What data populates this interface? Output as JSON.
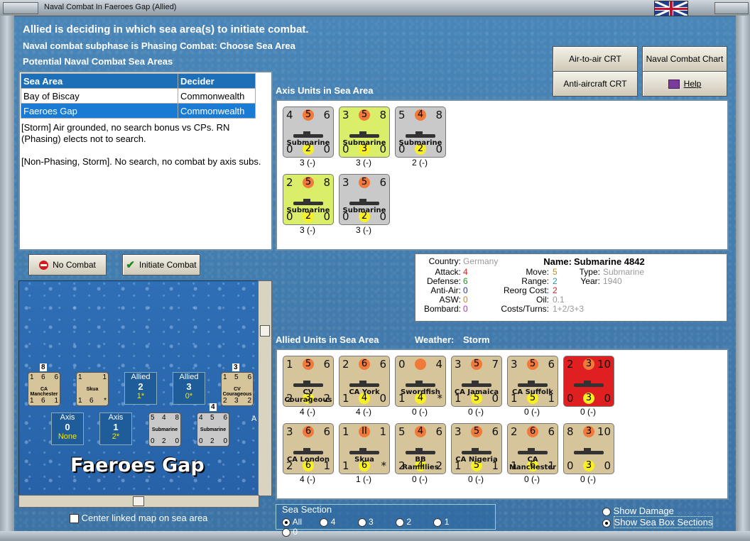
{
  "window": {
    "title": "Naval Combat In Faeroes Gap (Allied)"
  },
  "header": {
    "line1": "Allied is deciding in which sea area(s) to initiate combat.",
    "line2": "Naval combat subphase is Phasing Combat: Choose Sea Area",
    "line3": "Potential Naval Combat Sea Areas"
  },
  "buttons": {
    "air_to_air": "Air-to-air CRT",
    "naval_chart": "Naval Combat Chart",
    "anti_aircraft": "Anti-aircraft CRT",
    "help": "Help",
    "no_combat": "No Combat",
    "initiate_combat": "Initiate Combat"
  },
  "sea_table": {
    "headers": [
      "Sea Area",
      "Decider"
    ],
    "rows": [
      {
        "area": "Bay of Biscay",
        "decider": "Commonwealth"
      },
      {
        "area": "Faeroes Gap",
        "decider": "Commonwealth"
      }
    ]
  },
  "notes": [
    "[Storm] Air grounded, no search bonus vs CPs.  RN (Phasing) elects not to search.",
    "[Non-Phasing, Storm].  No search, no combat by axis subs."
  ],
  "axis_section": {
    "title": "Axis Units in Sea Area"
  },
  "axis_units": [
    {
      "tl": "4",
      "tc": "5",
      "tr": "6",
      "name": "Submarine",
      "bl": "0",
      "bc": "2",
      "br": "0",
      "label": "3 (-)",
      "color": "#c9c9c9"
    },
    {
      "tl": "3",
      "tc": "5",
      "tr": "8",
      "name": "Submarine",
      "bl": "0",
      "bc": "3",
      "br": "0",
      "label": "3 (-)",
      "color": "#dbee6a"
    },
    {
      "tl": "5",
      "tc": "4",
      "tr": "8",
      "name": "Submarine",
      "bl": "0",
      "bc": "2",
      "br": "0",
      "label": "2 (-)",
      "color": "#c9c9c9"
    },
    {
      "tl": "2",
      "tc": "5",
      "tr": "8",
      "name": "Submarine",
      "bl": "0",
      "bc": "2",
      "br": "0",
      "label": "3 (-)",
      "color": "#dbee6a"
    },
    {
      "tl": "3",
      "tc": "5",
      "tr": "6",
      "name": "Submarine",
      "bl": "0",
      "bc": "2",
      "br": "0",
      "label": "3 (-)",
      "color": "#c9c9c9"
    }
  ],
  "info": {
    "country_k": "Country:",
    "country_v": "Germany",
    "attack_k": "Attack:",
    "attack_v": "4",
    "defense_k": "Defense:",
    "defense_v": "6",
    "antiair_k": "Anti-Air:",
    "antiair_v": "0",
    "asw_k": "ASW:",
    "asw_v": "0",
    "bombard_k": "Bombard:",
    "bombard_v": "0",
    "move_k": "Move:",
    "move_v": "5",
    "range_k": "Range:",
    "range_v": "2",
    "reorg_k": "Reorg Cost:",
    "reorg_v": "2",
    "oil_k": "Oil:",
    "oil_v": "0.1",
    "costs_k": "Costs/Turns:",
    "costs_v": "1+2/3+3",
    "name_k": "Name:",
    "name_v": "Submarine 4842",
    "type_k": "Type:",
    "type_v": "Submarine",
    "year_k": "Year:",
    "year_v": "1940"
  },
  "allied_section": {
    "title": "Allied Units in Sea Area",
    "weather_label": "Weather:",
    "weather_value": "Storm"
  },
  "allied_units": [
    {
      "tl": "1",
      "tc": "5",
      "tr": "6",
      "name": "CV Courageous",
      "bl": "2",
      "bc": "3",
      "br": "2",
      "label": "4 (-)",
      "color": "#d6c49a"
    },
    {
      "tl": "2",
      "tc": "6",
      "tr": "6",
      "name": "CA York",
      "bl": "1",
      "bc": "4",
      "br": "0",
      "label": "4 (-)",
      "color": "#d6c49a"
    },
    {
      "tl": "0",
      "tc": "",
      "tr": "4",
      "name": "Swordfish",
      "bl": "1",
      "bc": "4",
      "br": "*",
      "label": "0 (-)",
      "color": "#d6c49a"
    },
    {
      "tl": "3",
      "tc": "5",
      "tr": "7",
      "name": "CA Jamaica",
      "bl": "1",
      "bc": "5",
      "br": "0",
      "label": "0 (-)",
      "color": "#d6c49a"
    },
    {
      "tl": "3",
      "tc": "5",
      "tr": "6",
      "name": "CA Suffolk",
      "bl": "1",
      "bc": "5",
      "br": "1",
      "label": "0 (-)",
      "color": "#d6c49a"
    },
    {
      "tl": "2",
      "tc": "3",
      "tr": "10",
      "name": "",
      "bl": "0",
      "bc": "3",
      "br": "0",
      "label": "0 (-)",
      "color": "#e02020"
    },
    {
      "tl": "3",
      "tc": "6",
      "tr": "6",
      "name": "CA London",
      "bl": "2",
      "bc": "6",
      "br": "1",
      "label": "4 (-)",
      "color": "#d6c49a"
    },
    {
      "tl": "1",
      "tc": "II",
      "tr": "1",
      "name": "Skua",
      "bl": "1",
      "bc": "6",
      "br": "*",
      "label": "1 (-)",
      "color": "#d6c49a"
    },
    {
      "tl": "5",
      "tc": "4",
      "tr": "6",
      "name": "BB Ramillies",
      "bl": "2",
      "bc": "4",
      "br": "2",
      "label": "0 (-)",
      "color": "#d6c49a"
    },
    {
      "tl": "3",
      "tc": "5",
      "tr": "6",
      "name": "CA Nigeria",
      "bl": "1",
      "bc": "5",
      "br": "1",
      "label": "0 (-)",
      "color": "#d6c49a"
    },
    {
      "tl": "2",
      "tc": "6",
      "tr": "6",
      "name": "CA Manchester",
      "bl": "1",
      "bc": "6",
      "br": "1",
      "label": "0 (-)",
      "color": "#d6c49a"
    },
    {
      "tl": "8",
      "tc": "3",
      "tr": "10",
      "name": "",
      "bl": "0",
      "bc": "3",
      "br": "0",
      "label": "0 (-)",
      "color": "#d6c49a"
    }
  ],
  "map": {
    "title": "Faeroes Gap",
    "allied_boxes": [
      {
        "label": "Allied",
        "num": "2",
        "sub": "1*"
      },
      {
        "label": "Allied",
        "num": "3",
        "sub": "0*"
      }
    ],
    "axis_boxes": [
      {
        "label": "Axis",
        "num": "0",
        "sub": "None"
      },
      {
        "label": "Axis",
        "num": "1",
        "sub": "2*"
      }
    ],
    "stack_counts": [
      "8",
      "3",
      "4"
    ],
    "mini_units": [
      {
        "name": "CA Manchester",
        "tl": "1",
        "tc": "6",
        "tr": "6",
        "bl": "1",
        "bc": "6",
        "br": "1",
        "color": "#d6c49a"
      },
      {
        "name": "Skua",
        "tl": "1",
        "tc": "",
        "tr": "1",
        "bl": "1",
        "bc": "6",
        "br": "*",
        "color": "#d6c49a"
      },
      {
        "name": "CV Courageous",
        "tl": "1",
        "tc": "5",
        "tr": "6",
        "bl": "2",
        "bc": "3",
        "br": "2",
        "color": "#d6c49a"
      },
      {
        "name": "Submarine",
        "tl": "5",
        "tc": "4",
        "tr": "8",
        "bl": "0",
        "bc": "2",
        "br": "0",
        "color": "#c9c9c9"
      },
      {
        "name": "Submarine",
        "tl": "4",
        "tc": "5",
        "tr": "6",
        "bl": "0",
        "bc": "2",
        "br": "0",
        "color": "#c9c9c9"
      }
    ],
    "axis_partial": "A"
  },
  "center_linked": "Center linked map on sea area",
  "sea_section": {
    "title": "Sea Section",
    "options": [
      "All",
      "4",
      "3",
      "2",
      "1",
      "0"
    ],
    "selected": "All"
  },
  "view_options": {
    "show_damage": "Show Damage",
    "show_sections": "Show Sea Box Sections",
    "selected": "Show Sea Box Sections"
  }
}
